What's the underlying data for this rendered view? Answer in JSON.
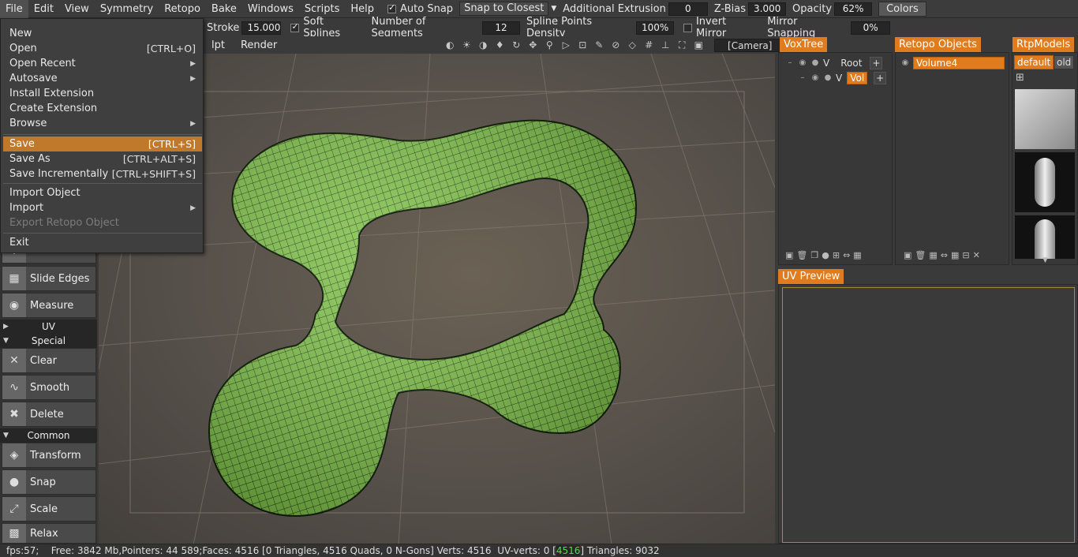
{
  "menubar": {
    "items": [
      "File",
      "Edit",
      "View",
      "Symmetry",
      "Retopo",
      "Bake",
      "Windows",
      "Scripts",
      "Help"
    ],
    "auto_snap_label": "Auto Snap",
    "snap_mode": "Snap to Closest",
    "additional_extrusion_label": "Additional Extrusion",
    "additional_extrusion_value": "0",
    "z_bias_label": "Z-Bias",
    "z_bias_value": "3.000",
    "opacity_label": "Opacity",
    "opacity_value": "62%",
    "colors_button": "Colors"
  },
  "toolbar2": {
    "stroke_label": "Stroke",
    "stroke_value": "15.000",
    "soft_splines_label": "Soft Splines",
    "segments_label": "Number of Segments",
    "segments_value": "12",
    "spline_density_label": "Spline Points Density",
    "spline_density_value": "100%",
    "invert_mirror_label": "Invert Mirror",
    "mirror_snapping_label": "Mirror Snapping",
    "mirror_snapping_value": "0%"
  },
  "viewport_toolbar": {
    "tabs": [
      "lpt",
      "Render"
    ],
    "camera": "[Camera]"
  },
  "file_menu": {
    "items": [
      {
        "label": "New",
        "shortcut": ""
      },
      {
        "label": "Open",
        "shortcut": "[CTRL+O]"
      },
      {
        "label": "Open Recent",
        "shortcut": ""
      },
      {
        "label": "Autosave",
        "shortcut": ""
      },
      {
        "label": "Install Extension",
        "shortcut": ""
      },
      {
        "label": "Create Extension",
        "shortcut": ""
      },
      {
        "label": "Browse",
        "shortcut": ""
      },
      {
        "label": "Save",
        "shortcut": "[CTRL+S]"
      },
      {
        "label": "Save As",
        "shortcut": "[CTRL+ALT+S]"
      },
      {
        "label": "Save Incrementally",
        "shortcut": "[CTRL+SHIFT+S]"
      },
      {
        "label": "Import Object",
        "shortcut": ""
      },
      {
        "label": "Import",
        "shortcut": ""
      },
      {
        "label": "Export Retopo Object",
        "shortcut": ""
      },
      {
        "label": "Exit",
        "shortcut": ""
      }
    ]
  },
  "left_tools": {
    "slide_edges": "Slide Edges",
    "measure": "Measure",
    "uv_section": "UV",
    "special_section": "Special",
    "clear": "Clear",
    "smooth": "Smooth",
    "delete": "Delete",
    "common_section": "Common",
    "transform": "Transform",
    "snap": "Snap",
    "scale": "Scale",
    "relax": "Relax"
  },
  "voxtree": {
    "tab": "VoxTree",
    "root": "Root",
    "child": "Vol",
    "v_label": "V"
  },
  "retopo_objects": {
    "tab": "Retopo Objects",
    "item": "Volume4"
  },
  "rtp_models": {
    "tab": "RtpModels",
    "default_btn": "default",
    "old_btn": "old"
  },
  "uv_preview": {
    "tab": "UV Preview"
  },
  "status": {
    "fps": "fps:57;",
    "free": "Free: 3842 Mb,Pointers: 44 589;Faces: 4516 [0 Triangles, 4516 Quads, 0 N-Gons] Verts: 4516  UV-verts: 0 [",
    "uv_highlight": "4516",
    "triangles": "] Triangles: 9032"
  }
}
